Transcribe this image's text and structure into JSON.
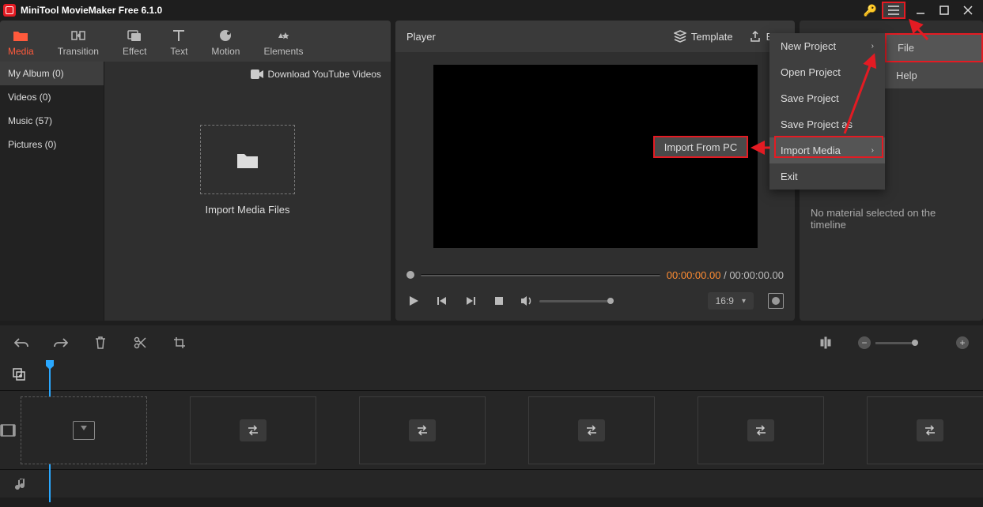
{
  "app_title": "MiniTool MovieMaker Free 6.1.0",
  "tabs": [
    {
      "label": "Media"
    },
    {
      "label": "Transition"
    },
    {
      "label": "Effect"
    },
    {
      "label": "Text"
    },
    {
      "label": "Motion"
    },
    {
      "label": "Elements"
    }
  ],
  "albums": [
    {
      "label": "My Album (0)"
    },
    {
      "label": "Videos (0)"
    },
    {
      "label": "Music (57)"
    },
    {
      "label": "Pictures (0)"
    }
  ],
  "download_yt": "Download YouTube Videos",
  "import_drop": "Import Media Files",
  "player": {
    "title": "Player",
    "template": "Template",
    "export": "Exp",
    "cur_time": "00:00:00.00",
    "sep": " / ",
    "total_time": "00:00:00.00",
    "ratio": "16:9"
  },
  "inspector": "No material selected on the timeline",
  "menu": {
    "items": [
      {
        "label": "New Project",
        "arrow": true
      },
      {
        "label": "Open Project"
      },
      {
        "label": "Save Project"
      },
      {
        "label": "Save Project as"
      },
      {
        "label": "Import Media",
        "arrow": true,
        "hover": true
      },
      {
        "label": "Exit"
      }
    ],
    "submenu": {
      "file": "File",
      "help": "Help"
    },
    "import_pc": "Import From PC"
  }
}
